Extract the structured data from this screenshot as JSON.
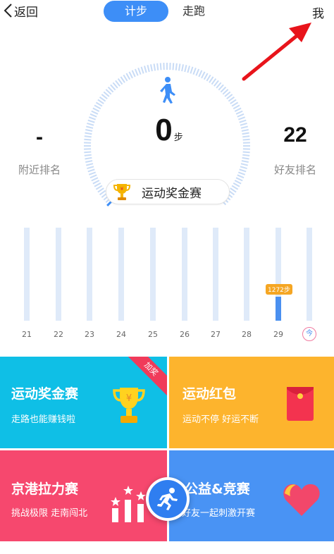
{
  "header": {
    "back_label": "返回",
    "tabs": [
      {
        "label": "计步",
        "active": true
      },
      {
        "label": "走跑",
        "active": false
      }
    ],
    "me_label": "我"
  },
  "pedometer": {
    "steps": "0",
    "steps_unit": "步",
    "nearby_rank_value": "-",
    "nearby_rank_label": "附近排名",
    "friend_rank_value": "22",
    "friend_rank_label": "好友排名",
    "progress_fraction": 0.0,
    "prize_chip_label": "运动奖金赛"
  },
  "history": {
    "days": [
      "21",
      "22",
      "23",
      "24",
      "25",
      "26",
      "27",
      "28",
      "29"
    ],
    "steps": [
      0,
      0,
      0,
      0,
      0,
      0,
      0,
      0,
      1272
    ],
    "scale_max_steps": 5000,
    "highlight_tag": "1272步",
    "today_label": "今"
  },
  "tiles": [
    {
      "title": "运动奖金赛",
      "subtitle": "走路也能赚钱啦",
      "badge": "加奖",
      "color": "#0fbfe6",
      "icon": "trophy-icon"
    },
    {
      "title": "运动红包",
      "subtitle": "运动不停 好运不断",
      "color": "#fdb42d",
      "icon": "red-envelope-icon"
    },
    {
      "title": "京港拉力赛",
      "subtitle": "挑战极限 走南闯北",
      "color": "#f6486e",
      "icon": "podium-icon"
    },
    {
      "title": "公益&竞赛",
      "subtitle": "好友一起刺激开赛",
      "color": "#4993f4",
      "icon": "heart-icon"
    }
  ],
  "run_button_icon": "runner-icon",
  "colors": {
    "accent": "#3d8ef7",
    "bar_fill": "#4a90f0",
    "bar_track": "#dfeaf9",
    "tag": "#f5a623",
    "annotation_arrow": "#e8141b"
  }
}
